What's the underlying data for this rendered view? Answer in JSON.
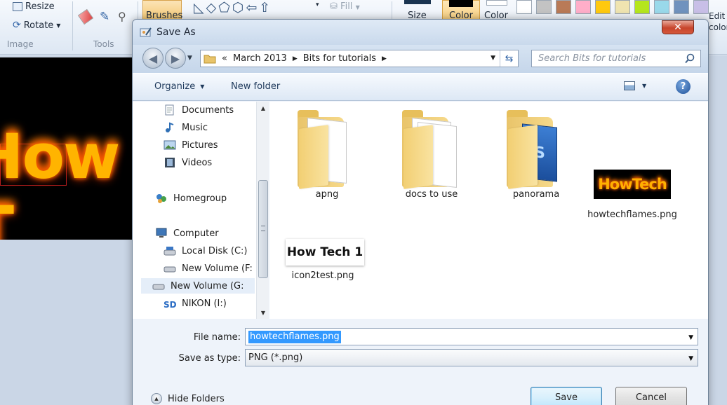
{
  "paint": {
    "resize_label": "Resize",
    "rotate_label": "Rotate",
    "image_group": "Image",
    "tools_group": "Tools",
    "brushes_label": "Brushes",
    "fill_label": "Fill",
    "size_label": "Size",
    "color1_label": "Color",
    "color2_label": "Color",
    "edit_colors_label": "Edit colors",
    "palette": [
      "#ffffff",
      "#c3c3c3",
      "#b97a57",
      "#ffaec9",
      "#ffc90e",
      "#efe4b0",
      "#b5e61d",
      "#99d9ea",
      "#7092be",
      "#c8bfe7"
    ],
    "canvas_text": "How T"
  },
  "dialog": {
    "title": "Save As",
    "close_glyph": "✕",
    "breadcrumb": {
      "overflow": "«",
      "parts": [
        "March 2013",
        "Bits for tutorials"
      ]
    },
    "search_placeholder": "Search Bits for tutorials",
    "commands": {
      "organize": "Organize",
      "new_folder": "New folder",
      "help": "?"
    },
    "nav": {
      "documents": "Documents",
      "music": "Music",
      "pictures": "Pictures",
      "videos": "Videos",
      "homegroup": "Homegroup",
      "computer": "Computer",
      "local_disk": "Local Disk (C:)",
      "new_volume_f": "New Volume (F:",
      "new_volume_g": "New Volume (G:",
      "nikon": "NIKON (I:)"
    },
    "files": {
      "apng": "apng",
      "docs": "docs to use",
      "panorama": "panorama",
      "flames": "howtechflames.png",
      "icon2": "icon2test.png",
      "flames_thumb_text": "HowTech",
      "icon2_thumb_text": "How Tech 1"
    },
    "file_name_label": "File name:",
    "file_name_value": "howtechflames.png",
    "save_as_type_label": "Save as type:",
    "save_as_type_value": "PNG (*.png)",
    "hide_folders": "Hide Folders",
    "save_button": "Save",
    "cancel_button": "Cancel"
  }
}
